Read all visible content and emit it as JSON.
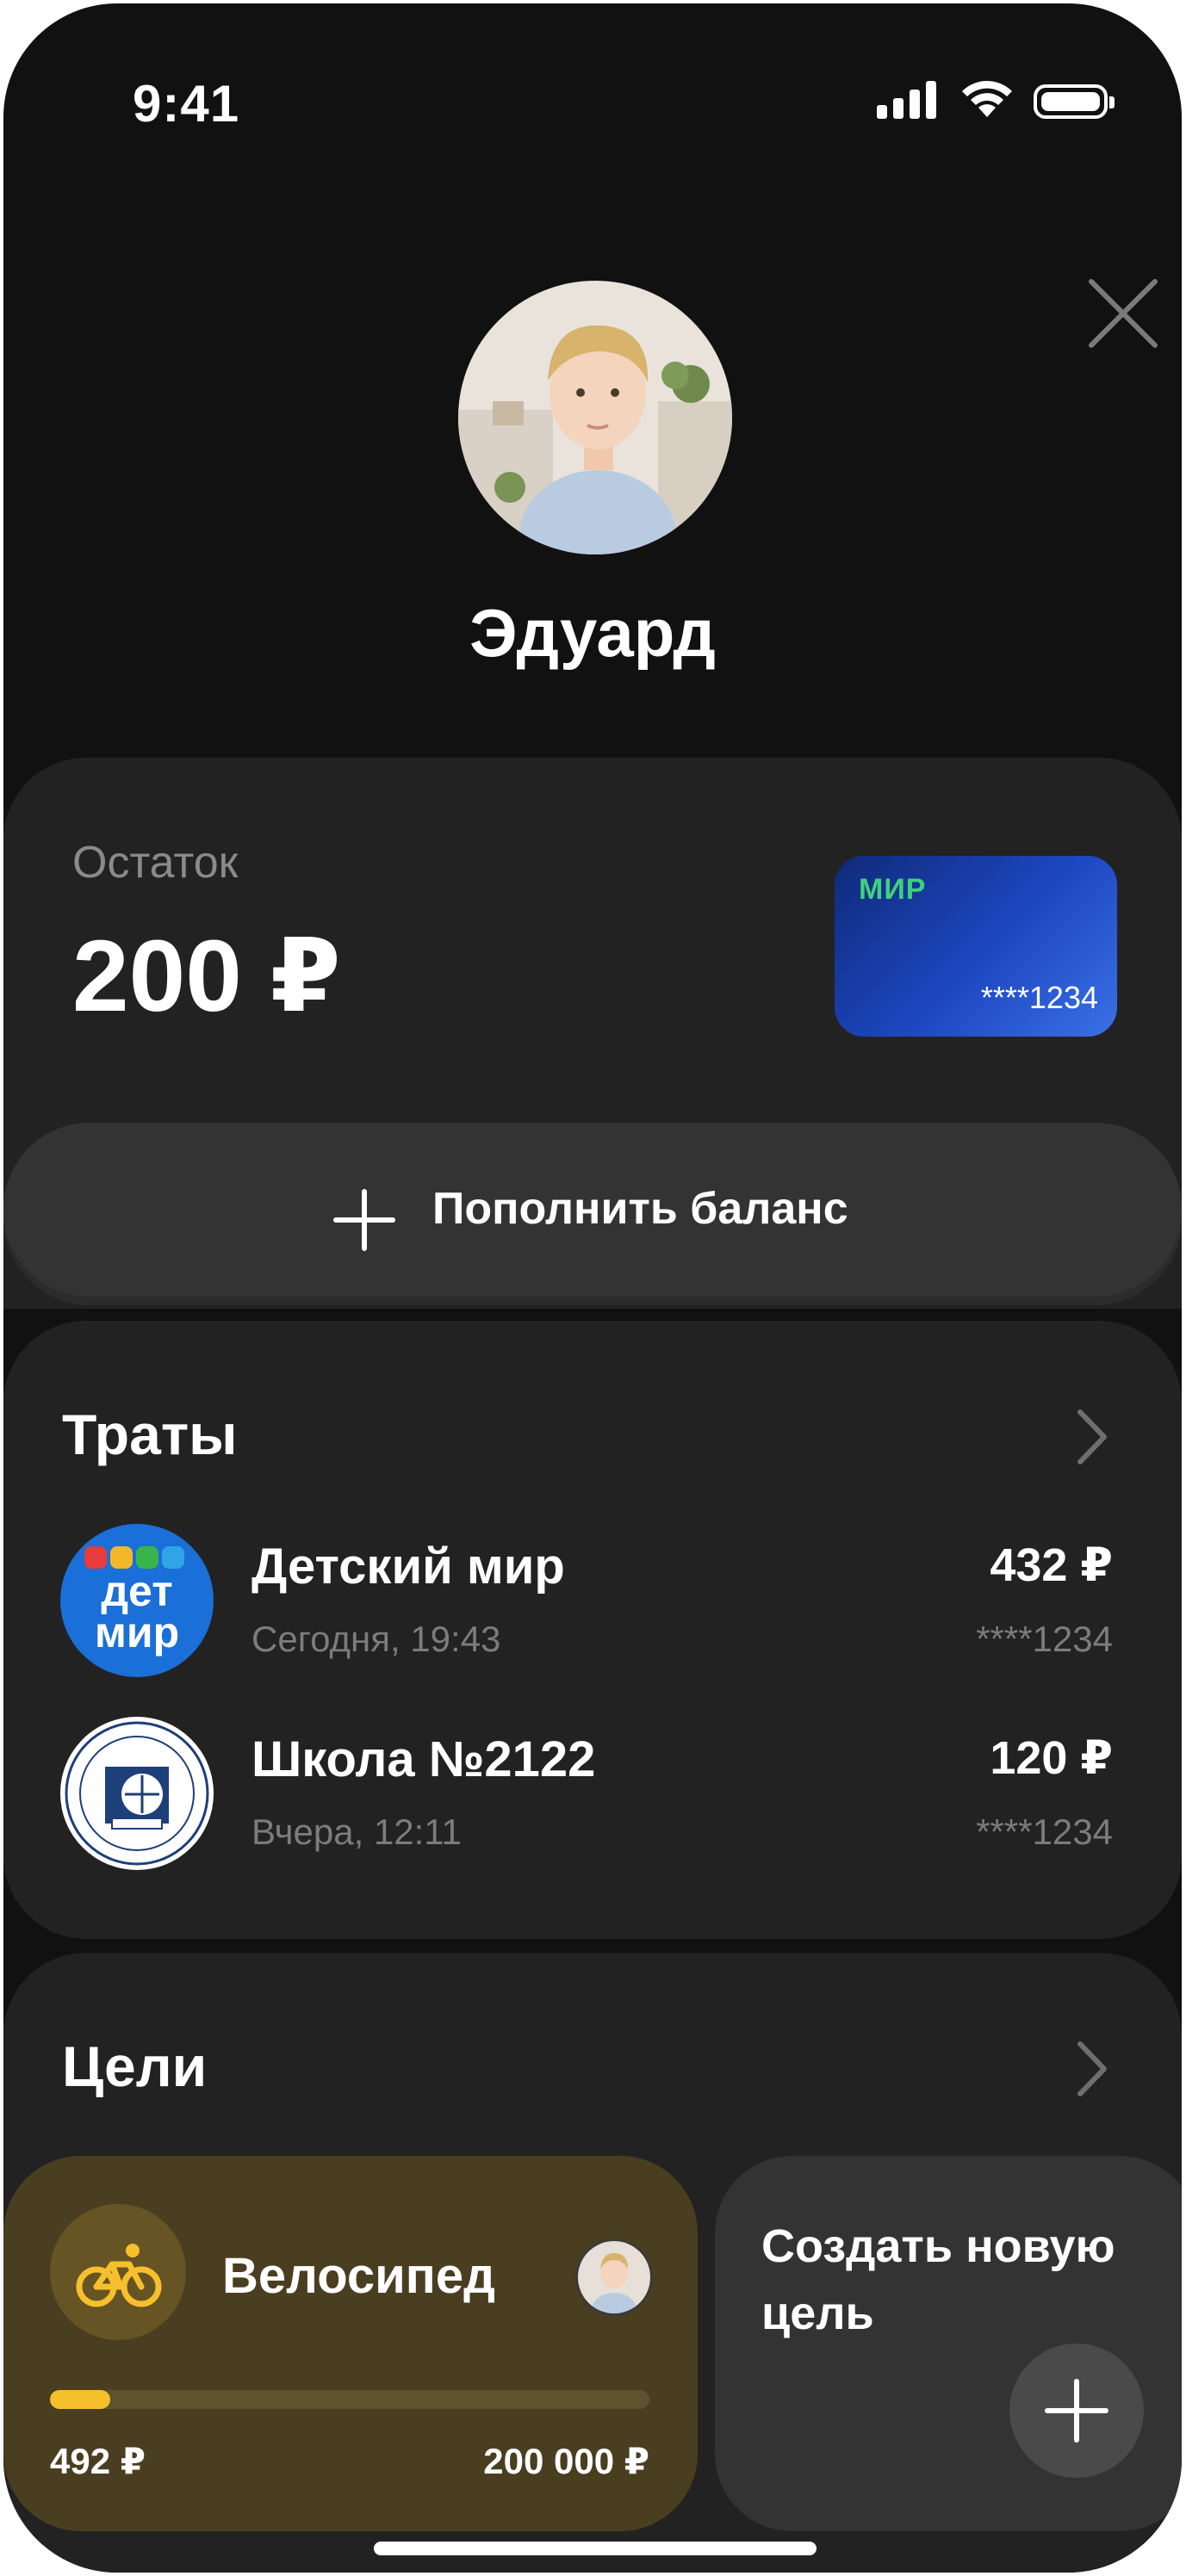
{
  "status_bar": {
    "time": "9:41"
  },
  "profile": {
    "name": "Эдуард"
  },
  "balance": {
    "label": "Остаток",
    "value": "200 ₽",
    "card_brand": "МИР",
    "card_number": "****1234"
  },
  "topup": {
    "label": "Пополнить баланс"
  },
  "spending": {
    "title": "Траты",
    "items": [
      {
        "title": "Детский мир",
        "subtitle": "Сегодня, 19:43",
        "amount": "432 ₽",
        "card": "****1234",
        "logo_line1": "дет",
        "logo_line2": "мир"
      },
      {
        "title": "Школа №2122",
        "subtitle": "Вчера, 12:11",
        "amount": "120 ₽",
        "card": "****1234"
      }
    ]
  },
  "goals": {
    "title": "Цели",
    "goal": {
      "title": "Велосипед",
      "current": "492 ₽",
      "target": "200 000 ₽",
      "progress_percent": 10
    },
    "create_label": "Создать новую цель"
  },
  "colors": {
    "background": "#111111",
    "card": "#222222",
    "accent_yellow": "#f6c02c",
    "goal_bg": "#4a3e21",
    "card_blue": "#1e48c2"
  }
}
